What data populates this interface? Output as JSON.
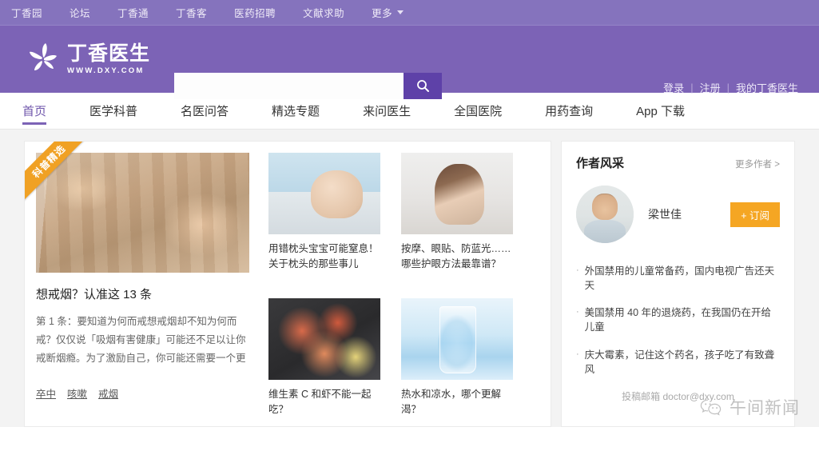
{
  "topbar": {
    "items": [
      {
        "label": "丁香园"
      },
      {
        "label": "论坛"
      },
      {
        "label": "丁香通"
      },
      {
        "label": "丁香客"
      },
      {
        "label": "医药招聘"
      },
      {
        "label": "文献求助"
      }
    ],
    "more_label": "更多"
  },
  "header": {
    "logo_title": "丁香医生",
    "logo_sub": "WWW.DXY.COM",
    "search": {
      "value": "",
      "placeholder": "",
      "icon": "search-icon"
    },
    "links": [
      {
        "label": "登录"
      },
      {
        "label": "注册"
      },
      {
        "label": "我的丁香医生"
      }
    ],
    "divider": "|",
    "bg_color": "#7c63b6",
    "topbar_color": "#8573bd"
  },
  "mainnav": {
    "items": [
      {
        "label": "首页",
        "active": true
      },
      {
        "label": "医学科普",
        "active": false
      },
      {
        "label": "名医问答",
        "active": false
      },
      {
        "label": "精选专题",
        "active": false
      },
      {
        "label": "来问医生",
        "active": false
      },
      {
        "label": "全国医院",
        "active": false
      },
      {
        "label": "用药查询",
        "active": false
      },
      {
        "label": "App 下载",
        "active": false
      }
    ],
    "accent_color": "#7c63b6"
  },
  "feature": {
    "ribbon": "科普精选",
    "ribbon_color": "#f0a124",
    "image": "hands-passing-cigarette-and-bottle-photo",
    "title": "想戒烟？认准这 13 条",
    "desc": "第 1 条：要知道为何而戒想戒烟却不知为何而戒？仅仅说「吸烟有害健康」可能还不足以让你戒断烟瘾。为了激励自己，你可能还需要一个更",
    "tags": [
      {
        "label": "卒中"
      },
      {
        "label": "咳嗽"
      },
      {
        "label": "戒烟"
      }
    ]
  },
  "cards": [
    {
      "image": "baby-on-pillow-photo",
      "title": "用错枕头宝宝可能窒息！关于枕头的那些事儿"
    },
    {
      "image": "woman-rubbing-eyes-photo",
      "title": "按摩、眼贴、防蓝光……哪些护眼方法最靠谱？"
    },
    {
      "image": "grilled-shrimp-plate-photo",
      "title": "维生素 C 和虾不能一起吃？"
    },
    {
      "image": "glass-of-water-splash-photo",
      "title": "热水和凉水，哪个更解渴？"
    }
  ],
  "sidebar": {
    "title": "作者风采",
    "more_label": "更多作者 >",
    "author": {
      "avatar": "male-doctor-portrait-photo",
      "name": "梁世佳",
      "subscribe_label": "+ 订阅",
      "subscribe_color": "#f5a623"
    },
    "links": [
      {
        "bullet": "·",
        "label": "外国禁用的儿童常备药，国内电视广告还天天"
      },
      {
        "bullet": "·",
        "label": "美国禁用 40 年的退烧药，在我国仍在开给儿童"
      },
      {
        "bullet": "·",
        "label": "庆大霉素，记住这个药名，孩子吃了有致聋风"
      }
    ],
    "footer": "投稿邮箱 doctor@dxy.com"
  },
  "watermark": {
    "icon": "wechat-icon",
    "label": "午间新闻"
  }
}
